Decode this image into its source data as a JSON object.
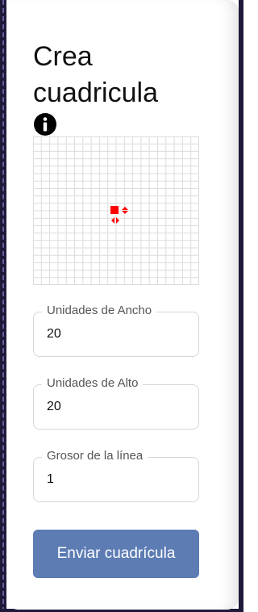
{
  "header": {
    "title": "Crea cuadricula",
    "info_icon": "info-icon"
  },
  "grid": {
    "columns": 20,
    "rows": 20,
    "line_color": "#dcdcdc",
    "marker_color": "#ff0000",
    "marker_icons": [
      "square-marker-icon",
      "vertical-resize-icon",
      "horizontal-resize-icon"
    ]
  },
  "form": {
    "width_label": "Unidades de Ancho",
    "width_value": "20",
    "height_label": "Unidades de Alto",
    "height_value": "20",
    "thickness_label": "Grosor de la línea",
    "thickness_value": "1",
    "submit_label": "Enviar cuadrícula"
  },
  "colors": {
    "accent": "#5c7cb3",
    "border": "#d6d6d6"
  }
}
